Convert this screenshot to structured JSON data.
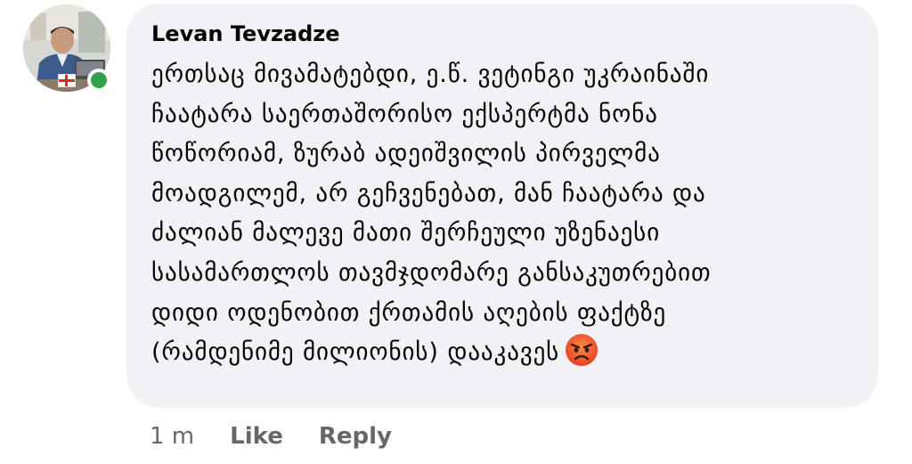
{
  "comment": {
    "author": "Levan Tevzadze",
    "lines": [
      "ერთსაც მივამატებდი, ე.წ. ვეტინგი უკრაინაში",
      "ჩაატარა საერთაშორისო ექსპერტმა ნონა",
      "წოწორიამ, ზურაბ ადეიშვილის პირველმა",
      "მოადგილემ, არ გეჩვენებათ, მან ჩაატარა და",
      "ძალიან მალევე მათი შერჩეული უზენაესი",
      "სასამართლოს თავმჯდომარე განსაკუთრებით",
      "დიდი ოდენობით ქრთამის აღების ფაქტზე",
      "(რამდენიმე მილიონის) დააკავეს"
    ],
    "emoji": "angry-face-emoji",
    "timestamp": "1 m",
    "like_label": "Like",
    "reply_label": "Reply",
    "status": "online"
  },
  "colors": {
    "bubble_bg": "#f0f2f5",
    "online": "#31a24c",
    "meta_text": "#65676b",
    "text": "#050505"
  }
}
